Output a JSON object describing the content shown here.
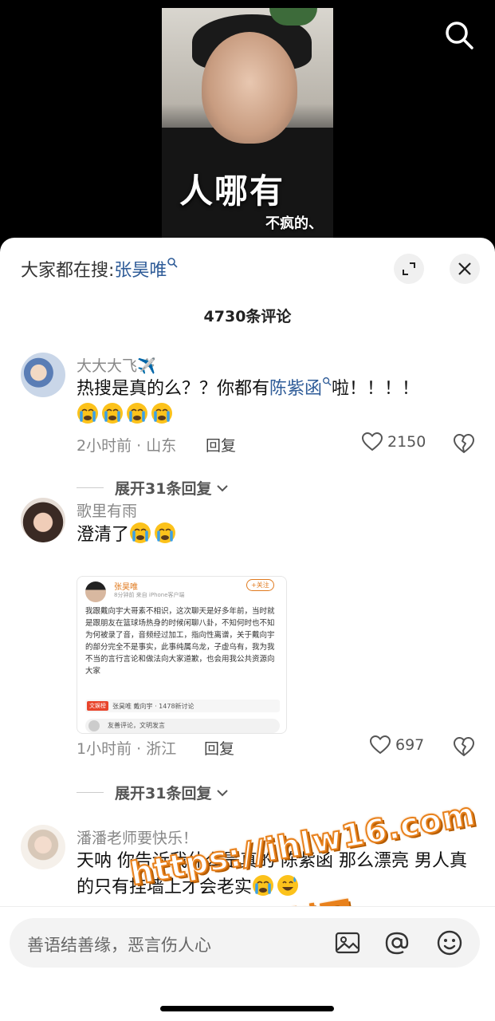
{
  "video": {
    "caption_line1": "人哪有",
    "caption_line2": "不疯的、"
  },
  "sheet": {
    "trending_prefix": "大家都在搜:",
    "trending_term": "张昊唯",
    "comment_count": "4730条评论"
  },
  "comments": [
    {
      "username": "大大大飞✈️",
      "text_before": "热搜是真的么？？你都有",
      "text_link": "陈紫函",
      "text_after": "啦！！！！",
      "emoji": [
        "loudly-crying-face-emoji",
        "loudly-crying-face-emoji",
        "loudly-crying-face-emoji",
        "loudly-crying-face-emoji"
      ],
      "time_location": "2小时前 · 山东",
      "reply": "回复",
      "likes": "2150",
      "expand_replies": "展开31条回复"
    },
    {
      "username": "歌里有雨",
      "text": "澄清了",
      "emoji": [
        "loudly-crying-face-emoji",
        "loudly-crying-face-emoji"
      ],
      "time_location": "1小时前 · 浙江",
      "reply": "回复",
      "likes": "697",
      "expand_replies": "展开31条回复"
    },
    {
      "username": "潘潘老师要快乐！",
      "text": "天呐 你告诉我什么是真的 陈紫函 那么漂亮 男人真的只有挂墙上才会老实",
      "emoji": [
        "loudly-crying-face-emoji",
        "grinning-sweat-emoji"
      ]
    }
  ],
  "embed": {
    "name": "张昊唯",
    "time": "8分钟前 来自 iPhone客户端",
    "follow": "+关注",
    "text": "我跟戴向宇大哥素不相识，这次聊天是好多年前，当时就是跟朋友在篮球场热身的时候闲聊八卦，不知何时也不知为何被录了音，音频经过加工，指向性离谱，关于戴向宇的部分完全不是事实，此事纯属乌龙，子虚乌有，我为我不当的言行言论和做法向大家道歉，也会用我公共资源向大家",
    "tag": "文娱榜",
    "tag_text": "张昊唯 戴向宇 · 1478新讨论",
    "comment_hint": "友善评论，文明发言"
  },
  "watermark": {
    "url": "https://ihlw16.com",
    "name": "黑料网"
  },
  "input": {
    "placeholder": "善语结善缘，恶言伤人心"
  },
  "colors": {
    "link": "#2f5c98",
    "watermark_stroke": "#e8811c"
  }
}
